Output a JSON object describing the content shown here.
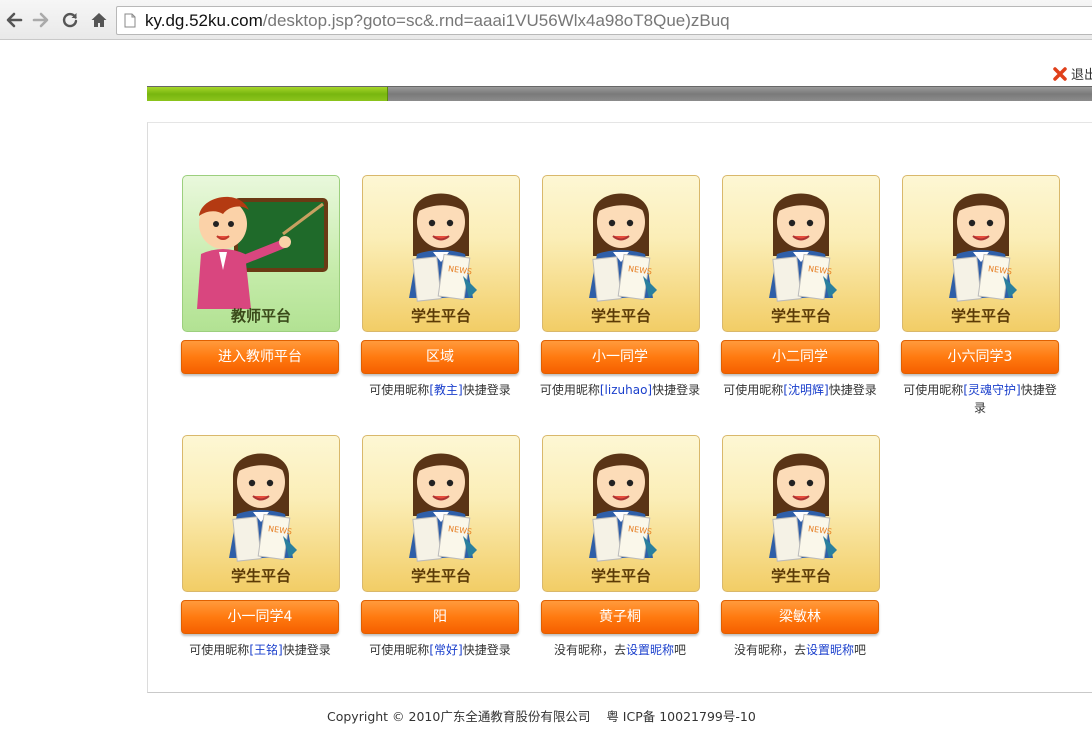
{
  "browser": {
    "url_host": "ky.dg.52ku.com",
    "url_path": "/desktop.jsp?goto=sc&.rnd=aaai1VU56Wlx4a98oT8Que)zBuq"
  },
  "header": {
    "logout_label": "退出"
  },
  "progress": {
    "fraction": 0.255
  },
  "cards": [
    {
      "title": "教师平台",
      "button": "进入教师平台",
      "hint_pre": "",
      "hint_nick": "",
      "hint_post": "",
      "kind": "teacher"
    },
    {
      "title": "学生平台",
      "button": "区域",
      "hint_pre": "可使用昵称",
      "hint_nick": "[教主]",
      "hint_post": "快捷登录",
      "kind": "student"
    },
    {
      "title": "学生平台",
      "button": "小一同学",
      "hint_pre": "可使用昵称",
      "hint_nick": "[lizuhao]",
      "hint_post": "快捷登录",
      "kind": "student"
    },
    {
      "title": "学生平台",
      "button": "小二同学",
      "hint_pre": "可使用昵称",
      "hint_nick": "[沈明辉]",
      "hint_post": "快捷登录",
      "kind": "student"
    },
    {
      "title": "学生平台",
      "button": "小六同学3",
      "hint_pre": "可使用昵称",
      "hint_nick": "[灵魂守护]",
      "hint_post": "快捷登录",
      "kind": "student"
    },
    {
      "title": "学生平台",
      "button": "小一同学4",
      "hint_pre": "可使用昵称",
      "hint_nick": "[王铭]",
      "hint_post": "快捷登录",
      "kind": "student"
    },
    {
      "title": "学生平台",
      "button": "阳",
      "hint_pre": "可使用昵称",
      "hint_nick": "[常好]",
      "hint_post": "快捷登录",
      "kind": "student"
    },
    {
      "title": "学生平台",
      "button": "黄子桐",
      "hint_pre": "没有昵称，去",
      "hint_link": "设置昵称",
      "hint_post": "吧",
      "kind": "student"
    },
    {
      "title": "学生平台",
      "button": "梁敏林",
      "hint_pre": "没有昵称，去",
      "hint_link": "设置昵称",
      "hint_post": "吧",
      "kind": "student"
    }
  ],
  "footer": {
    "copyright": "Copyright © 2010广东全通教育股份有限公司",
    "icp": "粤 ICP备 10021799号-10"
  },
  "colors": {
    "button_orange": "#ff7a10",
    "nick_blue": "#1a3fcc",
    "progress_green": "#78b60f"
  }
}
